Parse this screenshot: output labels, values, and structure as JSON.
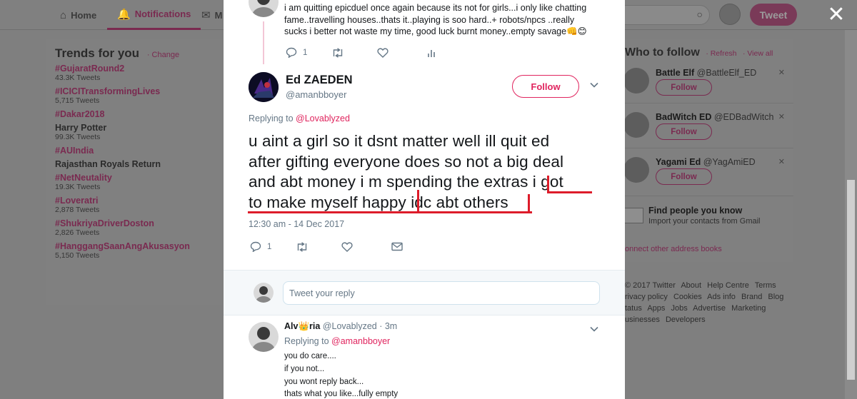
{
  "colors": {
    "accent": "#e0245e",
    "annotation_red": "#dd1c2a",
    "muted": "#657786",
    "overlay": "#7f7f7f"
  },
  "nav": {
    "home": "Home",
    "notifications": "Notifications",
    "messages": "M",
    "tweet_button": "Tweet"
  },
  "trends": {
    "title": "Trends for you",
    "change": "· Change",
    "items": [
      {
        "name": "#GujaratRound2",
        "count": "43.3K Tweets"
      },
      {
        "name": "#ICICITransformingLives",
        "count": "5,715 Tweets"
      },
      {
        "name": "#Dakar2018",
        "count": ""
      },
      {
        "name": "Harry Potter",
        "count": "99.3K Tweets"
      },
      {
        "name": "#AUIndia",
        "count": ""
      },
      {
        "name": "Rajasthan Royals Return",
        "count": ""
      },
      {
        "name": "#NetNeutality",
        "count": "19.3K Tweets"
      },
      {
        "name": "#Loveratri",
        "count": "2,878 Tweets"
      },
      {
        "name": "#ShukriyaDriverDoston",
        "count": "2,826 Tweets"
      },
      {
        "name": "#HanggangSaanAngAkusasyon",
        "count": "5,150 Tweets"
      }
    ]
  },
  "who_to_follow": {
    "title": "Who to follow",
    "refresh": "· Refresh",
    "view_all": "· View all",
    "accounts": [
      {
        "name": "Battle Elf",
        "handle": "@BattleElf_ED",
        "follow": "Follow"
      },
      {
        "name": "BadWitch ED",
        "handle": "@EDBadWitch",
        "follow": "Follow"
      },
      {
        "name": "Yagami Ed",
        "handle": "@YagAmiED",
        "follow": "Follow"
      }
    ],
    "find_title": "Find people you know",
    "find_sub": "Import your contacts from Gmail",
    "connect": "onnect other address books"
  },
  "footer": {
    "links": [
      "© 2017 Twitter",
      "About",
      "Help Centre",
      "Terms",
      "rivacy policy",
      "Cookies",
      "Ads info",
      "Brand",
      "Blog",
      "tatus",
      "Apps",
      "Jobs",
      "Advertise",
      "Marketing",
      "usinesses",
      "Developers"
    ]
  },
  "modal": {
    "prev_tweet": {
      "text": "i am quitting epicduel once again because its not for girls...i only like chatting fame..travelling houses..thats it..playing is soo hard..+ robots/npcs ..really sucks i better not waste my time, good luck burnt money..empty savage👊😊",
      "reply_count": "1"
    },
    "main_tweet": {
      "name": "Ed ZAEDEN",
      "handle": "@amanbboyer",
      "follow": "Follow",
      "replying_to_label": "Replying to",
      "replying_to_handle": "@Lovablyzed",
      "line1": "u aint a girl so it dsnt matter well ill quit ed",
      "line2": "after gifting everyone does so not a big deal",
      "line3": "and abt money i m spending the extras i got",
      "line4": "to make myself happy idc abt others",
      "timestamp": "12:30 am - 14 Dec 2017",
      "reply_count": "1"
    },
    "compose": {
      "placeholder": "Tweet your reply"
    },
    "reply": {
      "name": "Alv👑ria",
      "meta": "@Lovablyzed · 3m",
      "replying_to_label": "Replying to",
      "replying_to_handle": "@amanbboyer",
      "lines": [
        "you do care....",
        "if you not...",
        "you wont reply back...",
        "thats what you like...fully empty"
      ]
    }
  }
}
